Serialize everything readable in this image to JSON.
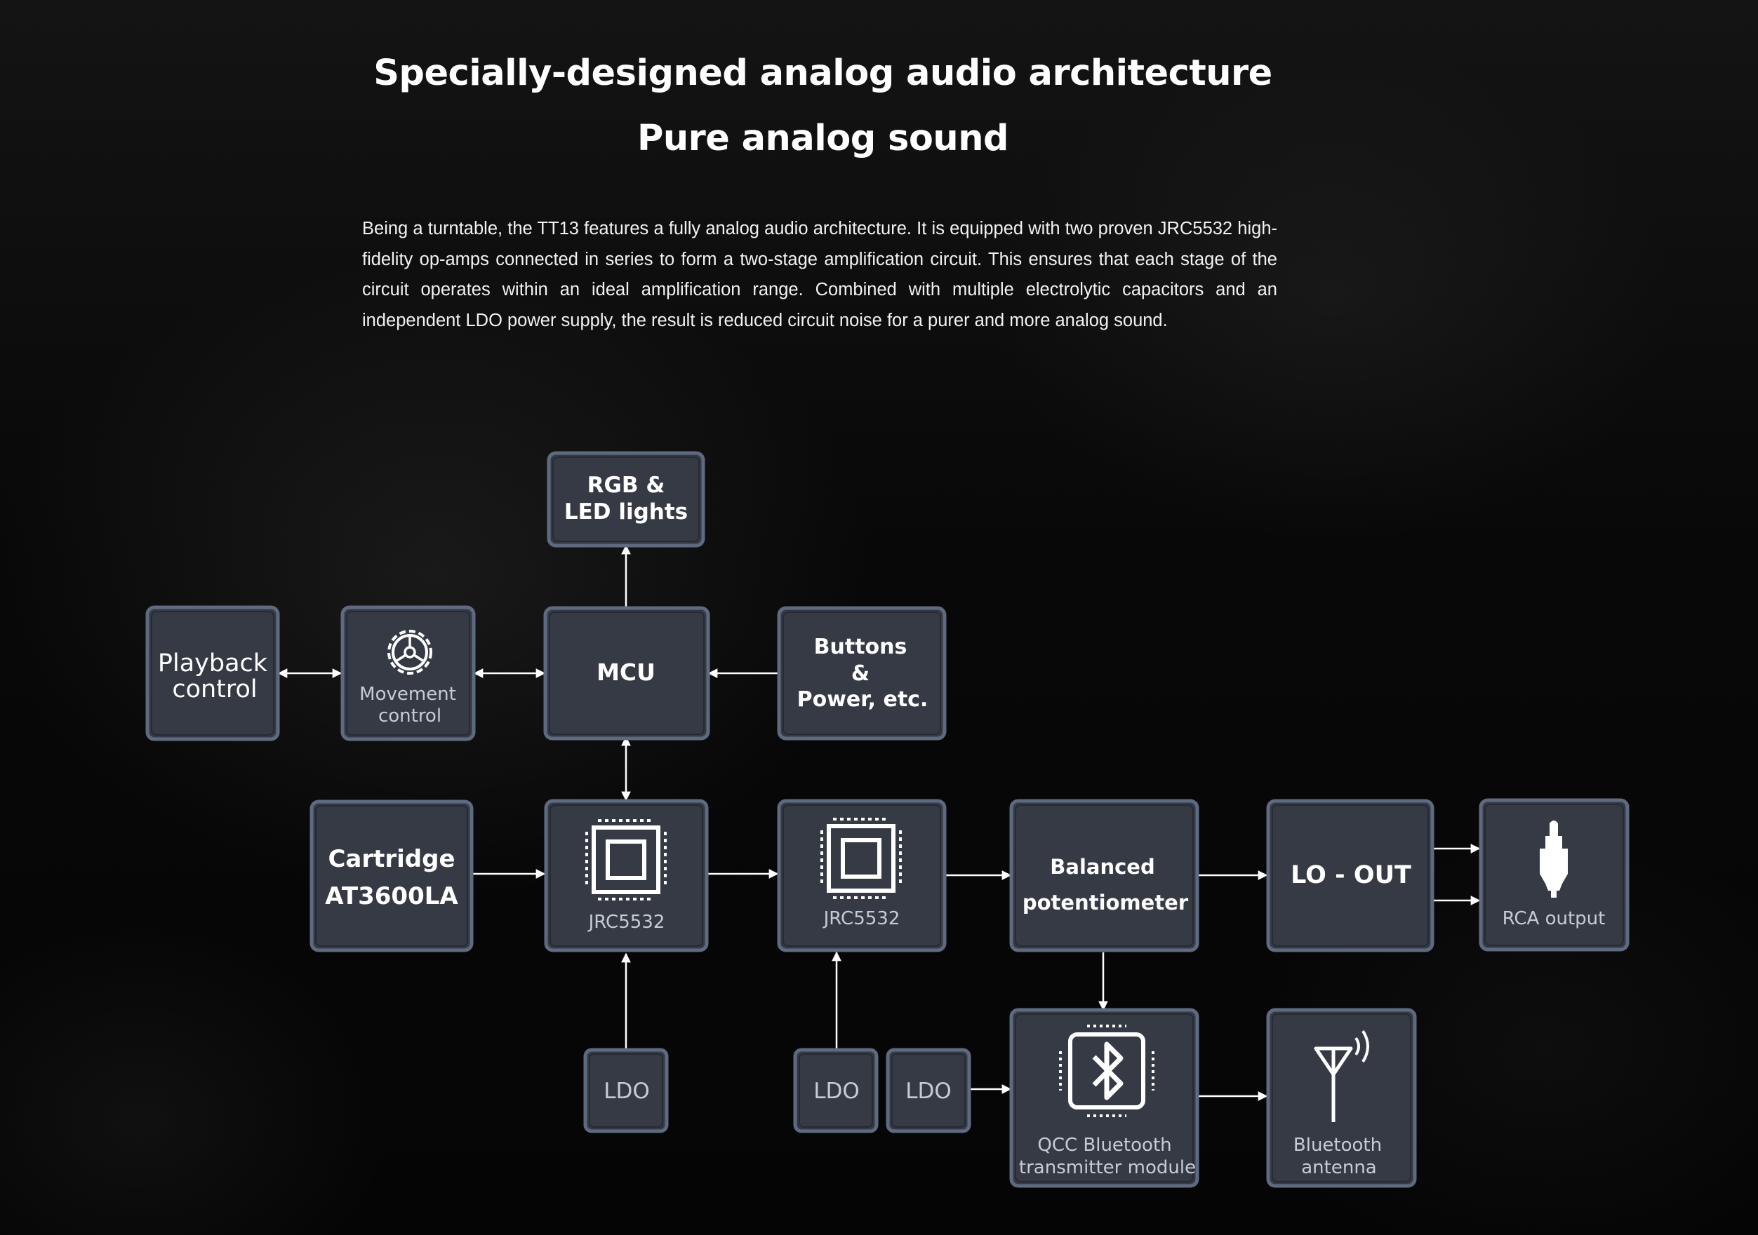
{
  "header": {
    "title": "Specially-designed analog audio architecture",
    "subtitle": "Pure analog sound"
  },
  "description": "Being a turntable, the TT13 features a fully analog audio architecture. It is equipped with two proven JRC5532 high-fidelity op-amps connected in series to form a two-stage amplification circuit. This ensures that each stage of the circuit operates within an ideal amplification range. Combined with multiple electrolytic capacitors and an independent LDO power supply, the result is reduced circuit noise for a purer and more analog sound.",
  "diagram": {
    "nodes": {
      "rgb": {
        "lines": [
          "RGB &",
          "LED lights"
        ]
      },
      "playback": {
        "lines": [
          "Playback",
          "control"
        ]
      },
      "movement": {
        "lines": [
          "Movement",
          "control"
        ],
        "icon": "gear-icon"
      },
      "mcu": {
        "lines": [
          "MCU"
        ]
      },
      "buttons": {
        "lines": [
          "Buttons",
          "&",
          "Power, etc."
        ]
      },
      "cartridge": {
        "lines": [
          "Cartridge",
          "AT3600LA"
        ]
      },
      "jrc1": {
        "lines": [
          "JRC5532"
        ],
        "icon": "chip-icon"
      },
      "jrc2": {
        "lines": [
          "JRC5532"
        ],
        "icon": "chip-icon"
      },
      "balanced": {
        "lines": [
          "Balanced",
          "potentiometer"
        ]
      },
      "loout": {
        "lines": [
          "LO - OUT"
        ]
      },
      "rca": {
        "lines": [
          "RCA output"
        ],
        "icon": "rca-plug-icon"
      },
      "ldo1": {
        "lines": [
          "LDO"
        ]
      },
      "ldo2": {
        "lines": [
          "LDO"
        ]
      },
      "ldo3": {
        "lines": [
          "LDO"
        ]
      },
      "qcc": {
        "lines": [
          "QCC Bluetooth",
          "transmitter module"
        ],
        "icon": "bluetooth-chip-icon"
      },
      "antenna": {
        "lines": [
          "Bluetooth",
          "antenna"
        ],
        "icon": "antenna-icon"
      }
    }
  }
}
